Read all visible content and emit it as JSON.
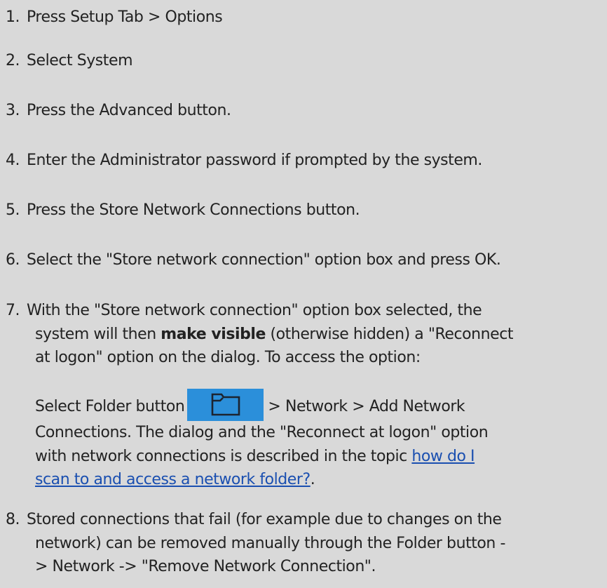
{
  "steps": [
    {
      "num": "1.",
      "text": "Press Setup Tab > Options"
    },
    {
      "num": "2.",
      "text": "Select System"
    },
    {
      "num": "3.",
      "text": "Press the Advanced button."
    },
    {
      "num": "4.",
      "text": "Enter the Administrator password if prompted by the system."
    },
    {
      "num": "5.",
      "text": "Press the Store Network Connections button."
    },
    {
      "num": "6.",
      "text": "Select the \"Store network connection\" option box and press OK."
    },
    {
      "num": "7.",
      "line1": "With the \"Store network connection\" option box selected, the",
      "line2_pre": "system will then ",
      "line2_bold": "make visible",
      "line2_post": " (otherwise hidden) a \"Reconnect",
      "line3": "at logon\" option on the dialog. To access the option:",
      "sub_line1_pre": "Select Folder button",
      "sub_line1_post": "> Network > Add Network",
      "sub_line2": "Connections. The dialog and the \"Reconnect at logon\" option",
      "sub_line3_pre": "with network connections is described in the topic ",
      "link_part1": "how do I",
      "link_part2": "scan to and access a network folder?",
      "sub_line4_post": "."
    },
    {
      "num": "8.",
      "line1": "Stored connections that fail (for example due to changes on the",
      "line2": "network) can be removed manually through the Folder button -",
      "line3": "> Network -> \"Remove Network Connection\"."
    }
  ],
  "icons": {
    "folder_button_icon": "folder-icon",
    "folder_button_color": "#2b8fda"
  }
}
